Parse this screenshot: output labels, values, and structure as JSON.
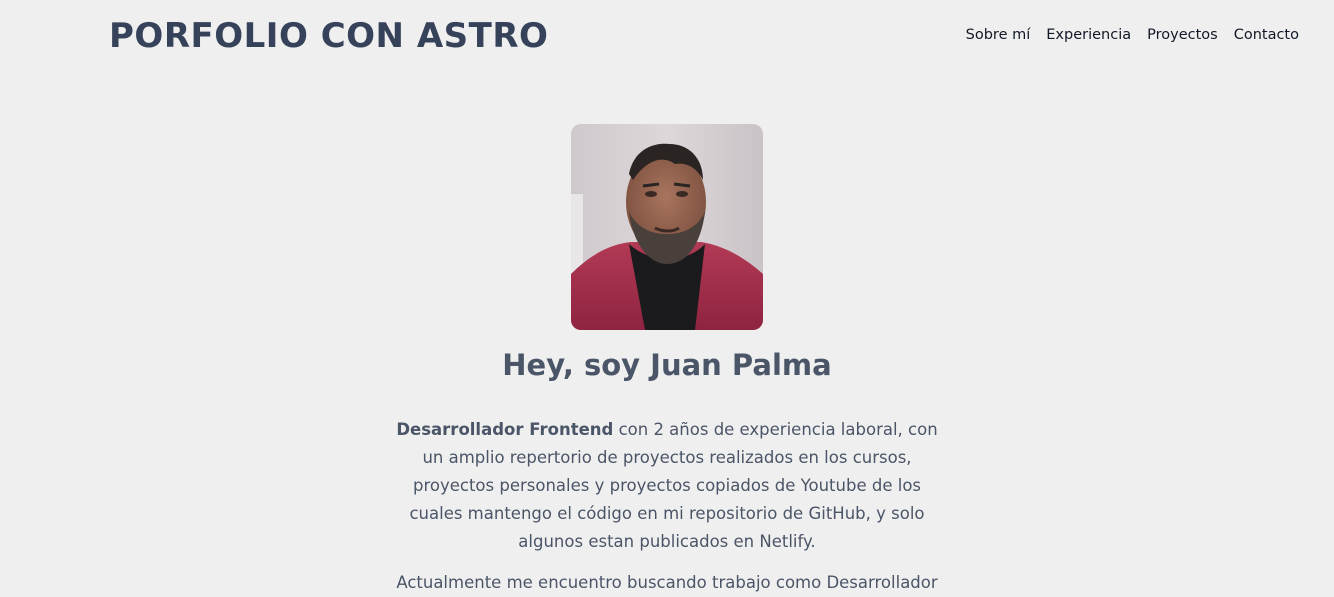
{
  "header": {
    "brand": "PORFOLIO CON ASTRO",
    "nav": [
      {
        "label": "Sobre mí"
      },
      {
        "label": "Experiencia"
      },
      {
        "label": "Proyectos"
      },
      {
        "label": "Contacto"
      }
    ]
  },
  "hero": {
    "title": "Hey, soy Juan Palma",
    "bio_strong": "Desarrollador Frontend",
    "bio_rest": " con 2 años de experiencia laboral, con un amplio repertorio de proyectos realizados en los cursos, proyectos personales y proyectos copiados de Youtube de los cuales mantengo el código en mi repositorio de GitHub, y solo algunos estan publicados en Netlify.",
    "bio_second": "Actualmente me encuentro buscando trabajo como Desarrollador"
  },
  "colors": {
    "background": "#efefef",
    "heading": "#36415a",
    "text": "#4b5568"
  }
}
